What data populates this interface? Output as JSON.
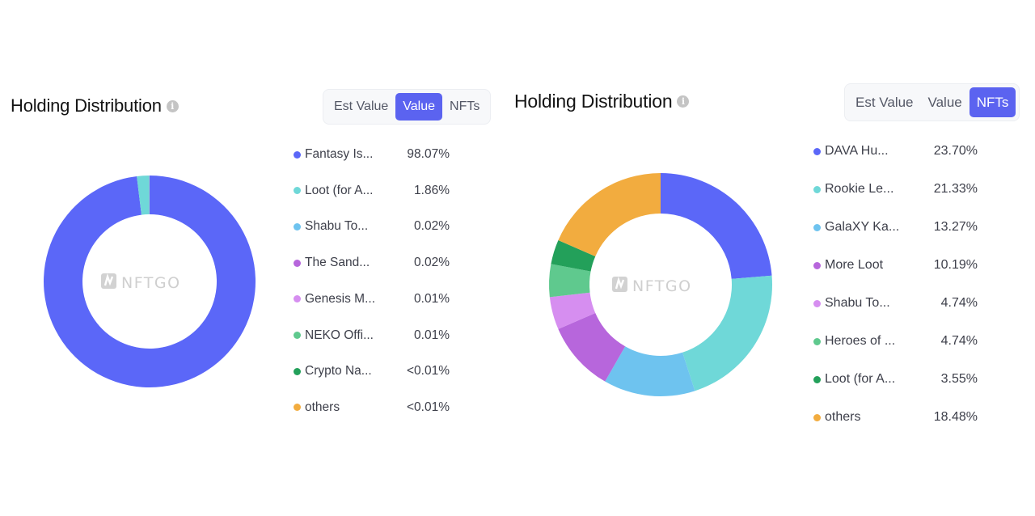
{
  "chart_data": [
    {
      "type": "pie",
      "variant": "donut",
      "title": "Holding Distribution",
      "watermark": "NFTGO",
      "active_tab": "Value",
      "categories": [
        "Fantasy Is...",
        "Loot (for A...",
        "Shabu To...",
        "The Sand...",
        "Genesis M...",
        "NEKO Offi...",
        "Crypto Na...",
        "others"
      ],
      "values": [
        98.07,
        1.86,
        0.02,
        0.02,
        0.01,
        0.01,
        0.005,
        0.005
      ],
      "value_labels": [
        "98.07%",
        "1.86%",
        "0.02%",
        "0.02%",
        "0.01%",
        "0.01%",
        "<0.01%",
        "<0.01%"
      ],
      "colors": [
        "#5b67f8",
        "#6fd8d8",
        "#6ec3ef",
        "#b766dc",
        "#d68ef0",
        "#5fc98e",
        "#23a05a",
        "#f2ac3f"
      ],
      "legend_position": "right"
    },
    {
      "type": "pie",
      "variant": "donut",
      "title": "Holding Distribution",
      "watermark": "NFTGO",
      "active_tab": "NFTs",
      "categories": [
        "DAVA Hu...",
        "Rookie Le...",
        "GalaXY Ka...",
        "More Loot",
        "Shabu To...",
        "Heroes of ...",
        "Loot (for A...",
        "others"
      ],
      "values": [
        23.7,
        21.33,
        13.27,
        10.19,
        4.74,
        4.74,
        3.55,
        18.48
      ],
      "value_labels": [
        "23.70%",
        "21.33%",
        "13.27%",
        "10.19%",
        "4.74%",
        "4.74%",
        "3.55%",
        "18.48%"
      ],
      "colors": [
        "#5b67f8",
        "#6fd8d8",
        "#6ec3ef",
        "#b766dc",
        "#d68ef0",
        "#5fc98e",
        "#23a05a",
        "#f2ac3f"
      ],
      "legend_position": "right"
    }
  ],
  "panels": [
    {
      "title": "Holding Distribution",
      "info_icon": "i",
      "tabs": [
        {
          "label": "Est Value",
          "active": false
        },
        {
          "label": "Value",
          "active": true
        },
        {
          "label": "NFTs",
          "active": false
        }
      ]
    },
    {
      "title": "Holding Distribution",
      "info_icon": "i",
      "tabs": [
        {
          "label": "Est Value",
          "active": false
        },
        {
          "label": "Value",
          "active": false
        },
        {
          "label": "NFTs",
          "active": true
        }
      ]
    }
  ],
  "colors": {
    "accent": "#5b63f0",
    "watermark": "#cfcfcf"
  }
}
